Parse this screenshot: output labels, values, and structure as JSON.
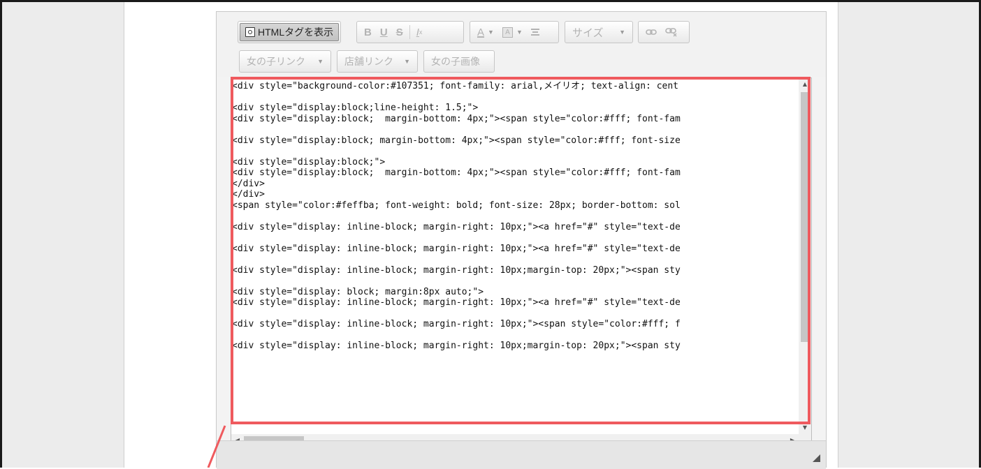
{
  "toolbar": {
    "row1": {
      "source_label": "HTMLタグを表示",
      "bold_label": "B",
      "underline_label": "U",
      "strike_label": "S",
      "remove_format_label": "I",
      "remove_format_sub": "x",
      "text_color_label": "A",
      "bg_color_label": "A",
      "size_label": "サイズ"
    },
    "row2": {
      "girl_link_label": "女の子リンク",
      "shop_link_label": "店舗リンク",
      "girl_image_label": "女の子画像"
    }
  },
  "code_lines": [
    "<div style=\"background-color:#107351; font-family: arial,メイリオ; text-align: cent",
    "",
    "<div style=\"display:block;line-height: 1.5;\">",
    "<div style=\"display:block;  margin-bottom: 4px;\"><span style=\"color:#fff; font-fam",
    "",
    "<div style=\"display:block; margin-bottom: 4px;\"><span style=\"color:#fff; font-size",
    "",
    "<div style=\"display:block;\">",
    "<div style=\"display:block;  margin-bottom: 4px;\"><span style=\"color:#fff; font-fam",
    "</div>",
    "</div>",
    "<span style=\"color:#feffba; font-weight: bold; font-size: 28px; border-bottom: sol",
    "",
    "<div style=\"display: inline-block; margin-right: 10px;\"><a href=\"#\" style=\"text-de",
    "",
    "<div style=\"display: inline-block; margin-right: 10px;\"><a href=\"#\" style=\"text-de",
    "",
    "<div style=\"display: inline-block; margin-right: 10px;margin-top: 20px;\"><span sty",
    "",
    "<div style=\"display: block; margin:8px auto;\">",
    "<div style=\"display: inline-block; margin-right: 10px;\"><a href=\"#\" style=\"text-de",
    "",
    "<div style=\"display: inline-block; margin-right: 10px;\"><span style=\"color:#fff; f",
    "",
    "<div style=\"display: inline-block; margin-right: 10px;margin-top: 20px;\"><span sty"
  ],
  "colors": {
    "highlight": "#ef5a5e",
    "frame": "#1a1a1a",
    "side_column": "#ececec"
  }
}
